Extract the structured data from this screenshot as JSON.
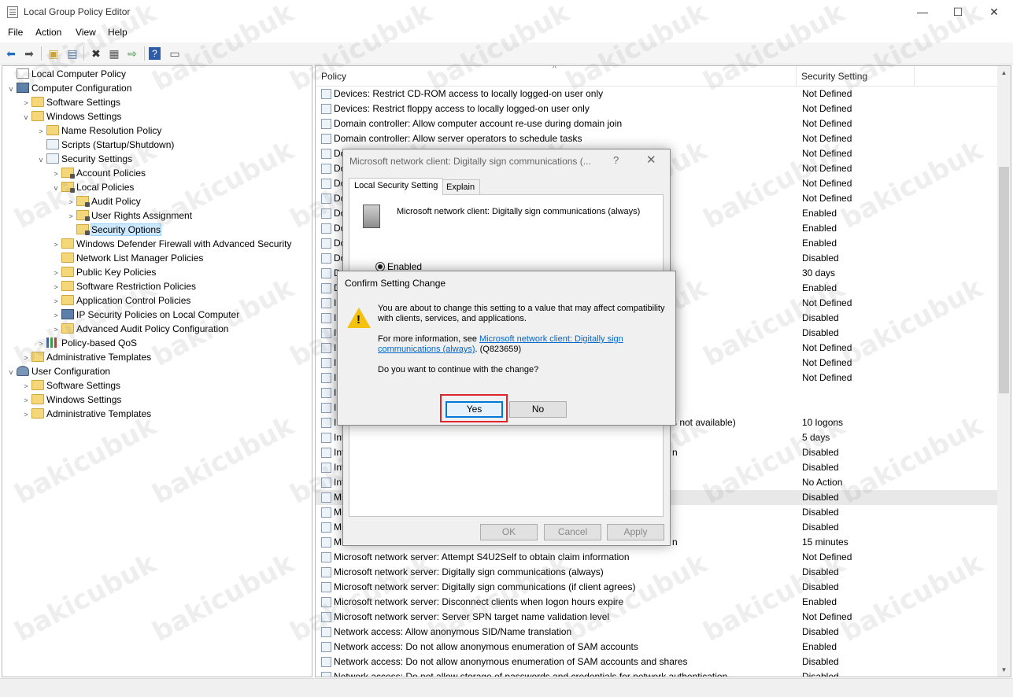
{
  "window": {
    "title": "Local Group Policy Editor",
    "minimize": "—",
    "maximize": "☐",
    "close": "✕"
  },
  "menu": [
    "File",
    "Action",
    "View",
    "Help"
  ],
  "toolbar_icons": [
    "back-arrow-icon",
    "forward-arrow-icon",
    "up-folder-icon",
    "show-hide-tree-icon",
    "delete-icon",
    "properties-icon",
    "export-icon",
    "help-icon",
    "view-icon"
  ],
  "tree": [
    {
      "label": "Local Computer Policy",
      "level": 0,
      "expander": "",
      "icon": "scroll-icon"
    },
    {
      "label": "Computer Configuration",
      "level": 0,
      "expander": "v",
      "icon": "computer-icon"
    },
    {
      "label": "Software Settings",
      "level": 1,
      "expander": ">",
      "icon": "folder-icon"
    },
    {
      "label": "Windows Settings",
      "level": 1,
      "expander": "v",
      "icon": "folder-icon"
    },
    {
      "label": "Name Resolution Policy",
      "level": 2,
      "expander": ">",
      "icon": "folder-icon"
    },
    {
      "label": "Scripts (Startup/Shutdown)",
      "level": 2,
      "expander": "",
      "icon": "doc-icon"
    },
    {
      "label": "Security Settings",
      "level": 2,
      "expander": "v",
      "icon": "security-icon"
    },
    {
      "label": "Account Policies",
      "level": 3,
      "expander": ">",
      "icon": "folder-lock-icon"
    },
    {
      "label": "Local Policies",
      "level": 3,
      "expander": "v",
      "icon": "folder-lock-icon"
    },
    {
      "label": "Audit Policy",
      "level": 4,
      "expander": ">",
      "icon": "folder-lock-icon"
    },
    {
      "label": "User Rights Assignment",
      "level": 4,
      "expander": ">",
      "icon": "folder-lock-icon"
    },
    {
      "label": "Security Options",
      "level": 4,
      "expander": "",
      "icon": "folder-lock-icon",
      "selected": true
    },
    {
      "label": "Windows Defender Firewall with Advanced Security",
      "level": 3,
      "expander": ">",
      "icon": "folder-icon"
    },
    {
      "label": "Network List Manager Policies",
      "level": 3,
      "expander": "",
      "icon": "folder-icon"
    },
    {
      "label": "Public Key Policies",
      "level": 3,
      "expander": ">",
      "icon": "folder-icon"
    },
    {
      "label": "Software Restriction Policies",
      "level": 3,
      "expander": ">",
      "icon": "folder-icon"
    },
    {
      "label": "Application Control Policies",
      "level": 3,
      "expander": ">",
      "icon": "folder-icon"
    },
    {
      "label": "IP Security Policies on Local Computer",
      "level": 3,
      "expander": ">",
      "icon": "ip-security-icon"
    },
    {
      "label": "Advanced Audit Policy Configuration",
      "level": 3,
      "expander": ">",
      "icon": "folder-icon"
    },
    {
      "label": "Policy-based QoS",
      "level": 2,
      "expander": ">",
      "icon": "chart-icon"
    },
    {
      "label": "Administrative Templates",
      "level": 1,
      "expander": ">",
      "icon": "folder-icon"
    },
    {
      "label": "User Configuration",
      "level": 0,
      "expander": "v",
      "icon": "user-icon"
    },
    {
      "label": "Software Settings",
      "level": 1,
      "expander": ">",
      "icon": "folder-icon"
    },
    {
      "label": "Windows Settings",
      "level": 1,
      "expander": ">",
      "icon": "folder-icon"
    },
    {
      "label": "Administrative Templates",
      "level": 1,
      "expander": ">",
      "icon": "folder-icon"
    }
  ],
  "list": {
    "col_policy": "Policy",
    "col_setting": "Security Setting",
    "sort_indicator": "^",
    "rows": [
      {
        "policy": "Devices: Restrict CD-ROM access to locally logged-on user only",
        "setting": "Not Defined"
      },
      {
        "policy": "Devices: Restrict floppy access to locally logged-on user only",
        "setting": "Not Defined"
      },
      {
        "policy": "Domain controller: Allow computer account re-use during domain join",
        "setting": "Not Defined"
      },
      {
        "policy": "Domain controller: Allow server operators to schedule tasks",
        "setting": "Not Defined"
      },
      {
        "policy": "Do",
        "setting": "Not Defined"
      },
      {
        "policy": "Do",
        "setting": "Not Defined"
      },
      {
        "policy": "Do",
        "setting": "Not Defined"
      },
      {
        "policy": "Do",
        "setting": "Not Defined"
      },
      {
        "policy": "Do",
        "setting": "Enabled"
      },
      {
        "policy": "Do",
        "setting": "Enabled"
      },
      {
        "policy": "Do",
        "setting": "Enabled"
      },
      {
        "policy": "Do",
        "setting": "Disabled"
      },
      {
        "policy": "D",
        "setting": "30 days"
      },
      {
        "policy": "D",
        "setting": "Enabled"
      },
      {
        "policy": "In",
        "setting": "Not Defined"
      },
      {
        "policy": "In",
        "setting": "Disabled"
      },
      {
        "policy": "In",
        "setting": "Disabled"
      },
      {
        "policy": "In",
        "setting": "Not Defined"
      },
      {
        "policy": "In",
        "setting": "Not Defined"
      },
      {
        "policy": "In",
        "setting": "Not Defined"
      },
      {
        "policy": "In",
        "setting": ""
      },
      {
        "policy": "In",
        "setting": ""
      },
      {
        "policy": "In",
        "setting": "10 logons",
        "tail": "s not available)"
      },
      {
        "policy": "Int",
        "setting": "5 days"
      },
      {
        "policy": "Int",
        "setting": "Disabled",
        "tail": "n"
      },
      {
        "policy": "Int",
        "setting": "Disabled"
      },
      {
        "policy": "Int",
        "setting": "No Action"
      },
      {
        "policy": "Mi",
        "setting": "Disabled",
        "highlight": true
      },
      {
        "policy": "Mi",
        "setting": "Disabled"
      },
      {
        "policy": "Mi",
        "setting": "Disabled"
      },
      {
        "policy": "Mi",
        "setting": "15 minutes",
        "tail": "n"
      },
      {
        "policy": "Microsoft network server: Attempt S4U2Self to obtain claim information",
        "setting": "Not Defined"
      },
      {
        "policy": "Microsoft network server: Digitally sign communications (always)",
        "setting": "Disabled"
      },
      {
        "policy": "Microsoft network server: Digitally sign communications (if client agrees)",
        "setting": "Disabled"
      },
      {
        "policy": "Microsoft network server: Disconnect clients when logon hours expire",
        "setting": "Enabled"
      },
      {
        "policy": "Microsoft network server: Server SPN target name validation level",
        "setting": "Not Defined"
      },
      {
        "policy": "Network access: Allow anonymous SID/Name translation",
        "setting": "Disabled"
      },
      {
        "policy": "Network access: Do not allow anonymous enumeration of SAM accounts",
        "setting": "Enabled"
      },
      {
        "policy": "Network access: Do not allow anonymous enumeration of SAM accounts and shares",
        "setting": "Disabled"
      },
      {
        "policy": "Network access: Do not allow storage of passwords and credentials for network authentication",
        "setting": "Disabled"
      }
    ]
  },
  "properties_dialog": {
    "title": "Microsoft network client: Digitally sign communications (...",
    "help": "?",
    "close": "✕",
    "tab_local": "Local Security Setting",
    "tab_explain": "Explain",
    "heading": "Microsoft network client: Digitally sign communications (always)",
    "radio_enabled": "Enabled",
    "ok": "OK",
    "cancel": "Cancel",
    "apply": "Apply"
  },
  "confirm_dialog": {
    "title": "Confirm Setting Change",
    "message": "You are about to change this setting to a value that may affect compatibility with clients, services, and applications.",
    "info_prefix": "For more information, see ",
    "info_link": "Microsoft network client: Digitally sign communications (always)",
    "info_suffix": ". (Q823659)",
    "question": "Do you want to continue with the change?",
    "yes": "Yes",
    "no": "No",
    "warning_glyph": "!"
  },
  "watermark": "bakicubuk",
  "colors": {
    "highlight_box": "#e0242c",
    "link": "#0066cc",
    "warning": "#f4c20d",
    "selection": "#cce8ff"
  }
}
